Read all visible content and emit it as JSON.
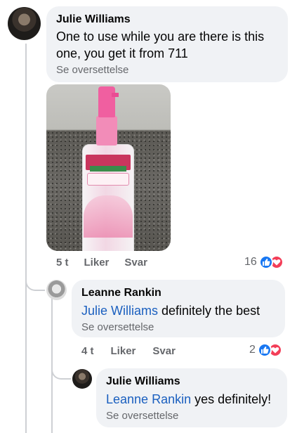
{
  "comments": [
    {
      "author": "Julie Williams",
      "text": "One to use while you are there is this one, you get it from 711",
      "translate": "Se oversettelse",
      "time": "5 t",
      "like": "Liker",
      "reply": "Svar",
      "reaction_count": "16"
    },
    {
      "author": "Leanne Rankin",
      "mention": "Julie Williams",
      "text": " definitely the best",
      "translate": "Se oversettelse",
      "time": "4 t",
      "like": "Liker",
      "reply": "Svar",
      "reaction_count": "2"
    },
    {
      "author": "Julie Williams",
      "mention": "Leanne Rankin",
      "text": " yes definitely!",
      "translate": "Se oversettelse"
    }
  ],
  "icons": {
    "like": "like-reaction-icon",
    "love": "love-reaction-icon"
  },
  "colors": {
    "link": "#1a5fbf",
    "like": "#1877f2",
    "love": "#f33e58",
    "bubble": "#f0f2f5",
    "meta": "#65676b"
  }
}
